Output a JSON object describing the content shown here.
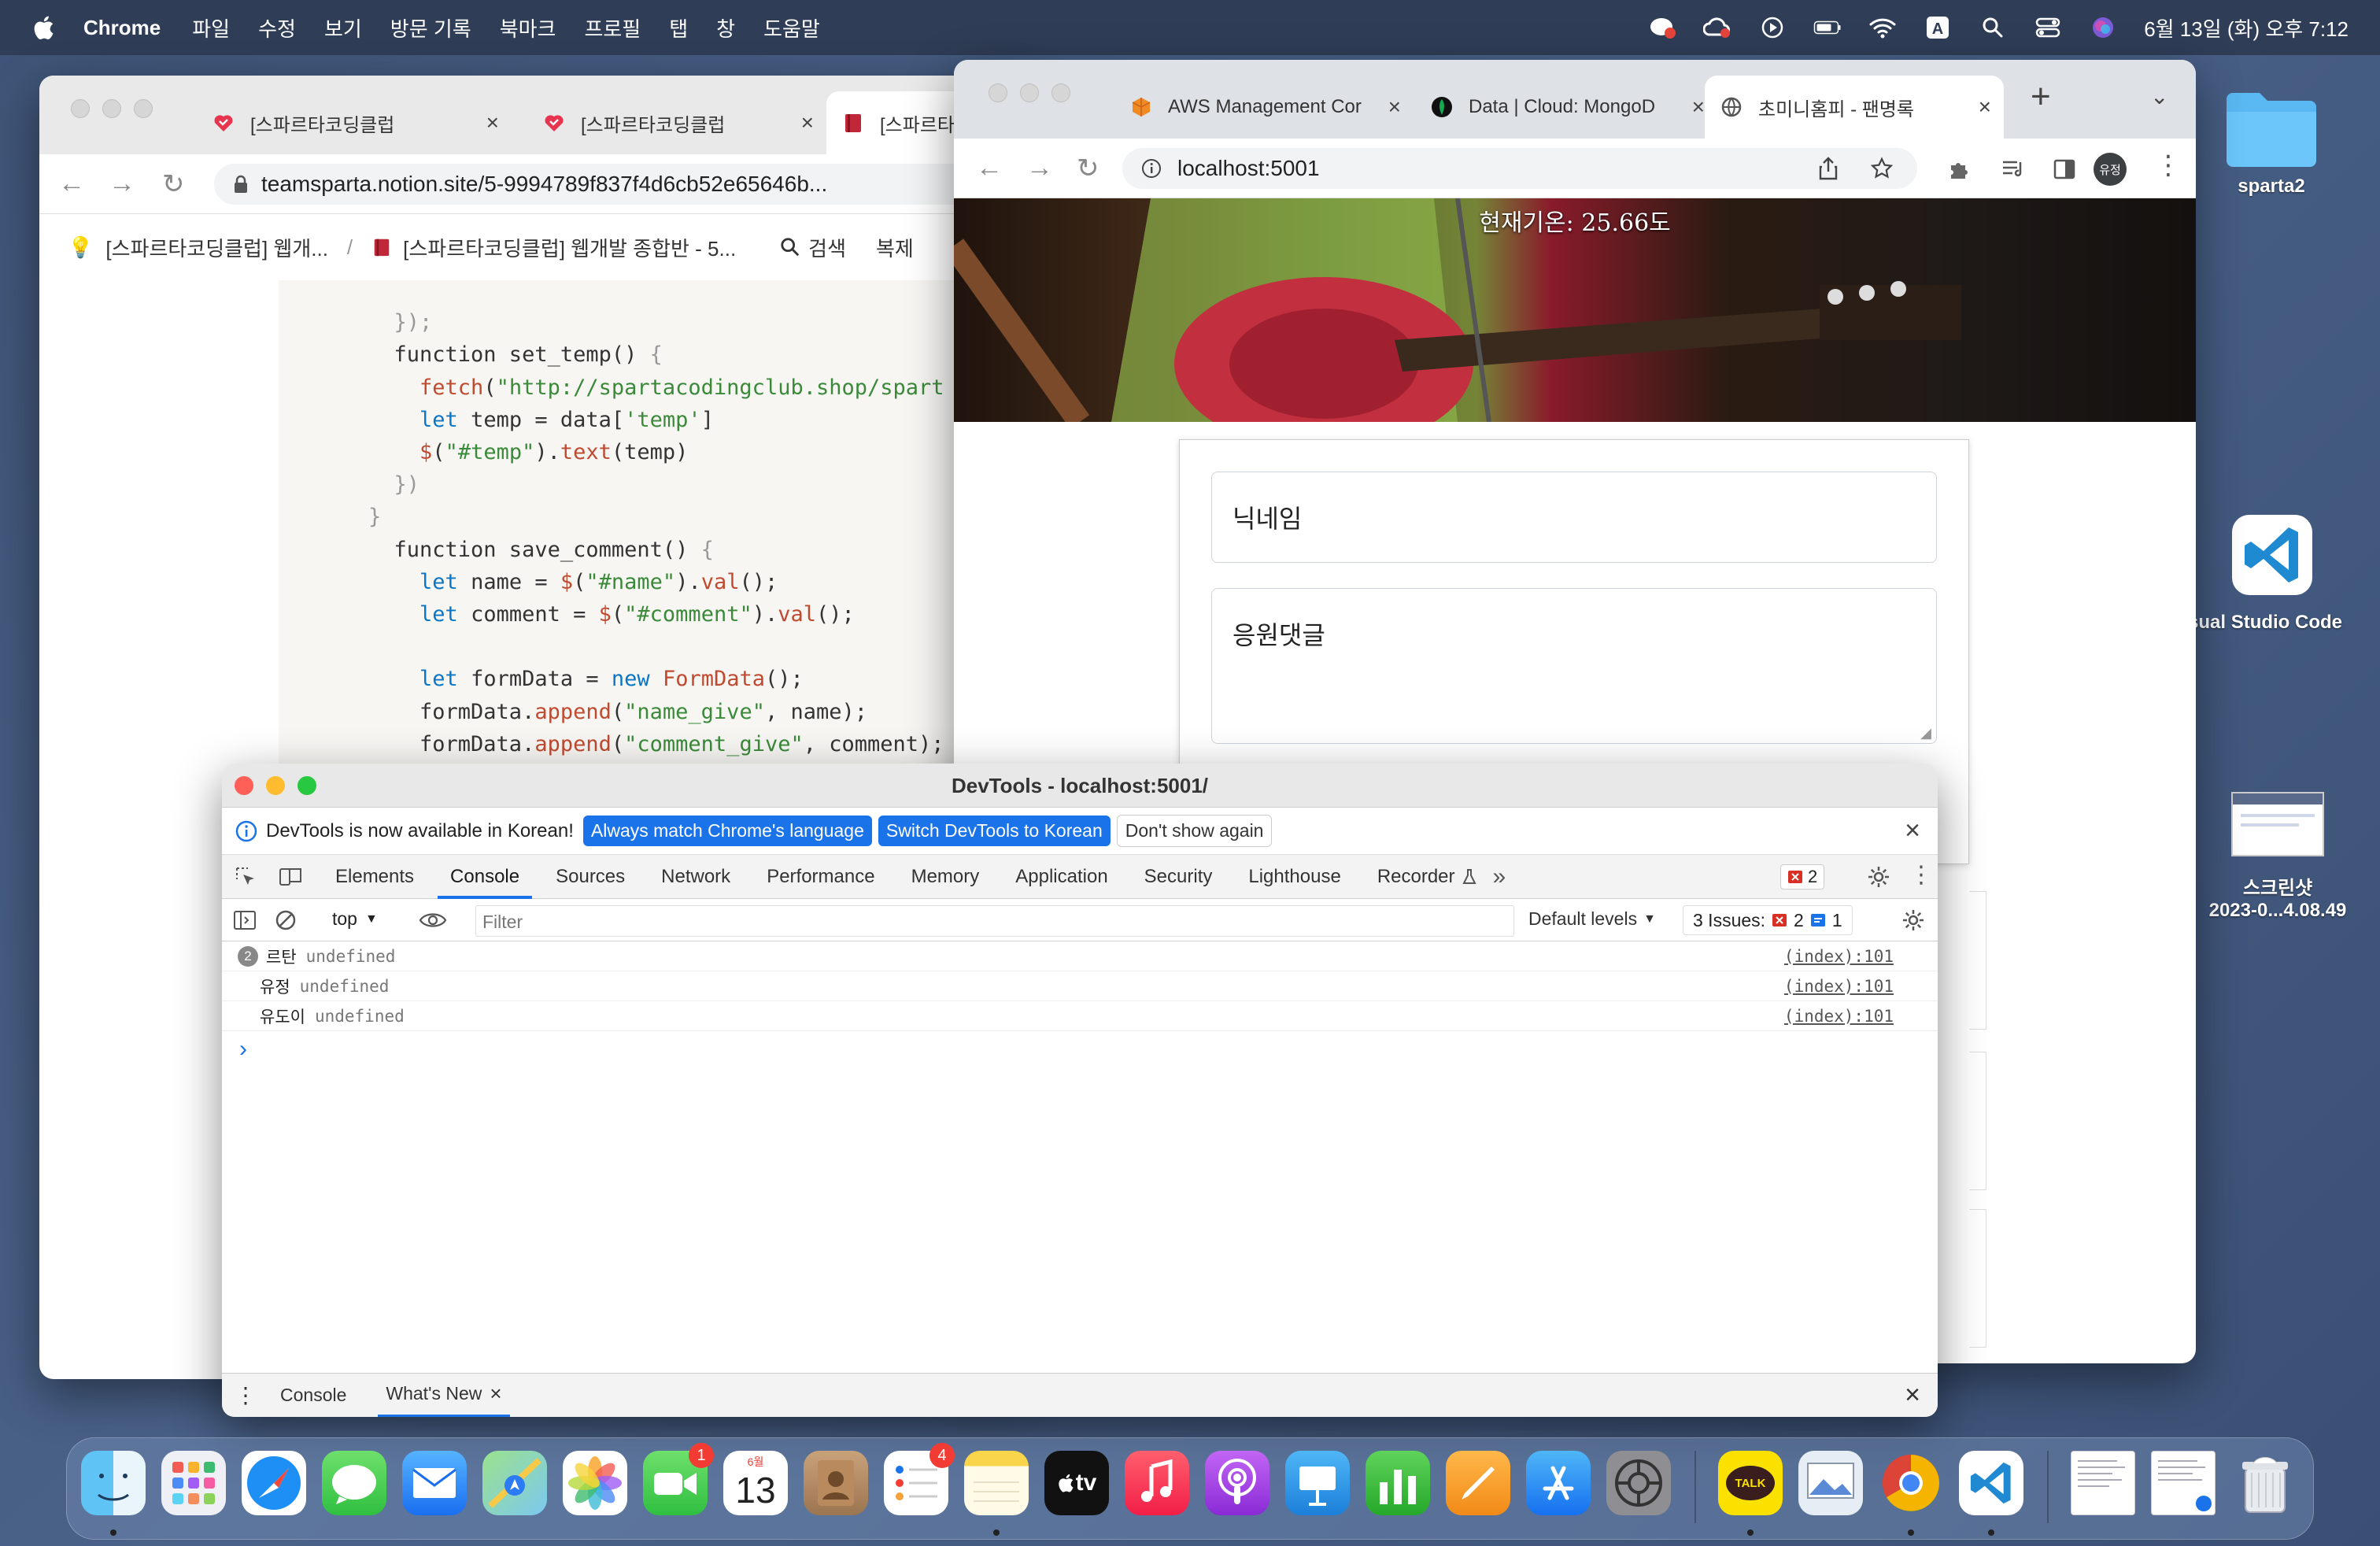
{
  "menubar": {
    "app_name": "Chrome",
    "items": [
      "파일",
      "수정",
      "보기",
      "방문 기록",
      "북마크",
      "프로필",
      "탭",
      "창",
      "도움말"
    ],
    "clock": "6월 13일 (화) 오후 7:12"
  },
  "desktop": {
    "icons": [
      {
        "label": "sparta2",
        "icon": "folder-icon"
      },
      {
        "label": "sual Studio Code",
        "icon": "vscode-icon"
      },
      {
        "label_line1": "스크린샷",
        "label_line2": "2023-0...4.08.49",
        "icon": "screenshot-thumbnail-icon"
      }
    ]
  },
  "notion_window": {
    "tabs": [
      {
        "label": "[스파르타코딩클럽",
        "icon": "sparta-heart-icon"
      },
      {
        "label": "[스파르타코딩클럽",
        "icon": "sparta-heart-icon"
      },
      {
        "label": "[스파르타코딩",
        "icon": "book-icon"
      }
    ],
    "url": "teamsparta.notion.site/5-9994789f837f4d6cb52e65646b...",
    "breadcrumb_1": "[스파르타코딩클럽] 웹개...",
    "breadcrumb_sep": "/",
    "breadcrumb_2": "[스파르타코딩클럽] 웹개발 종합반 - 5...",
    "search_label": "검색",
    "duplicate_label": "복제",
    "code_lines": [
      "  });",
      "  function set_temp() {",
      "    fetch(\"http://spartacodingclub.shop/spart",
      "    let temp = data['temp']",
      "    $(\"#temp\").text(temp)",
      "  })",
      "}",
      "  function save_comment() {",
      "    let name = $(\"#name\").val();",
      "    let comment = $(\"#comment\").val();",
      "",
      "    let formData = new FormData();",
      "    formData.append(\"name_give\", name);",
      "    formData.append(\"comment_give\", comment);"
    ]
  },
  "chrome_window": {
    "tabs": [
      {
        "label": "AWS Management Cor",
        "icon": "aws-icon"
      },
      {
        "label": "Data | Cloud: MongoD",
        "icon": "mongodb-leaf-icon"
      },
      {
        "label": "초미니홈피 - 팬명록",
        "icon": "globe-icon"
      }
    ],
    "url": "localhost:5001",
    "profile_label": "유정",
    "page": {
      "temp_text": "현재기온: 25.66도",
      "nickname_placeholder": "닉네임",
      "comment_placeholder": "응원댓글"
    }
  },
  "devtools": {
    "title": "DevTools - localhost:5001/",
    "banner_text": "DevTools is now available in Korean!",
    "banner_btn1": "Always match Chrome's language",
    "banner_btn2": "Switch DevTools to Korean",
    "banner_btn3": "Don't show again",
    "tabs": [
      "Elements",
      "Console",
      "Sources",
      "Network",
      "Performance",
      "Memory",
      "Application",
      "Security",
      "Lighthouse",
      "Recorder"
    ],
    "error_count": "2",
    "context": "top",
    "filter_placeholder": "Filter",
    "levels": "Default levels",
    "issues_label": "3 Issues:",
    "issues_err": "2",
    "issues_info": "1",
    "logs": [
      {
        "badge": "2",
        "name": "르탄",
        "value": "undefined",
        "src": "(index):101"
      },
      {
        "badge": "",
        "name": "유정",
        "value": "undefined",
        "src": "(index):101"
      },
      {
        "badge": "",
        "name": "유도이",
        "value": "undefined",
        "src": "(index):101"
      }
    ],
    "prompt": "›",
    "drawer_tabs": [
      "Console",
      "What's New"
    ]
  },
  "dock": {
    "facetime_badge": "1",
    "calendar_month": "6월",
    "calendar_day": "13",
    "reminders_badge": "4",
    "kakao_label": "TALK",
    "tv_label": "tv"
  },
  "colors": {
    "accent": "#1a73e8",
    "desktop": "#41577c",
    "error": "#d93025"
  }
}
